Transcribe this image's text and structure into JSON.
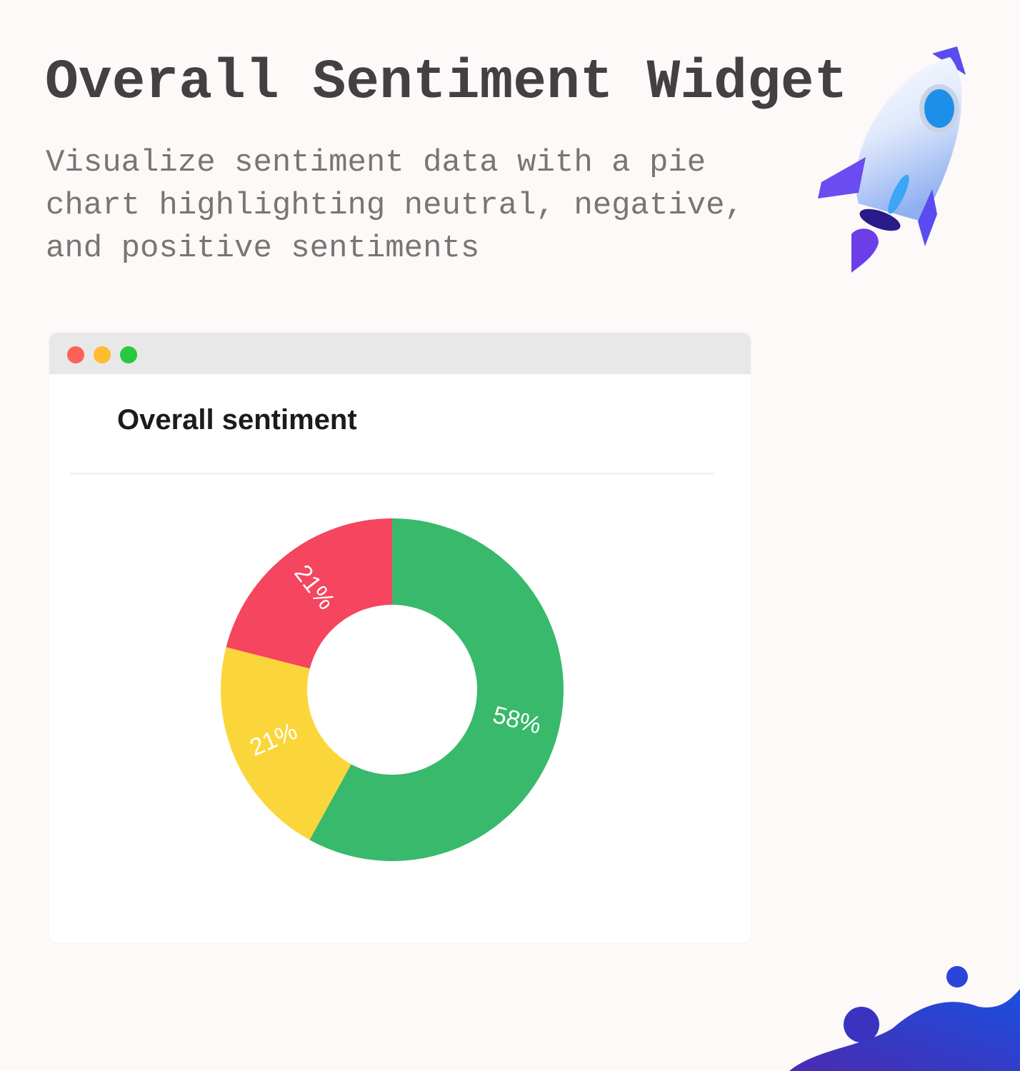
{
  "header": {
    "title": "Overall Sentiment Widget",
    "subtitle": "Visualize sentiment data with a pie chart highlighting neutral, negative, and positive sentiments"
  },
  "window": {
    "buttons": [
      {
        "name": "close",
        "color": "#fe5f57"
      },
      {
        "name": "minimize",
        "color": "#febc2e"
      },
      {
        "name": "maximize",
        "color": "#28c840"
      }
    ],
    "card_title": "Overall sentiment"
  },
  "chart_data": {
    "type": "pie",
    "style": "donut",
    "title": "Overall sentiment",
    "start": "top, clockwise",
    "values": [
      58,
      21,
      21
    ],
    "labels": [
      "58%",
      "21%",
      "21%"
    ],
    "colors": [
      "#38b96b",
      "#fbd63b",
      "#f5455f"
    ],
    "legend": "none"
  },
  "decor": {
    "icons": [
      "rocket-icon",
      "blob-decoration"
    ]
  }
}
